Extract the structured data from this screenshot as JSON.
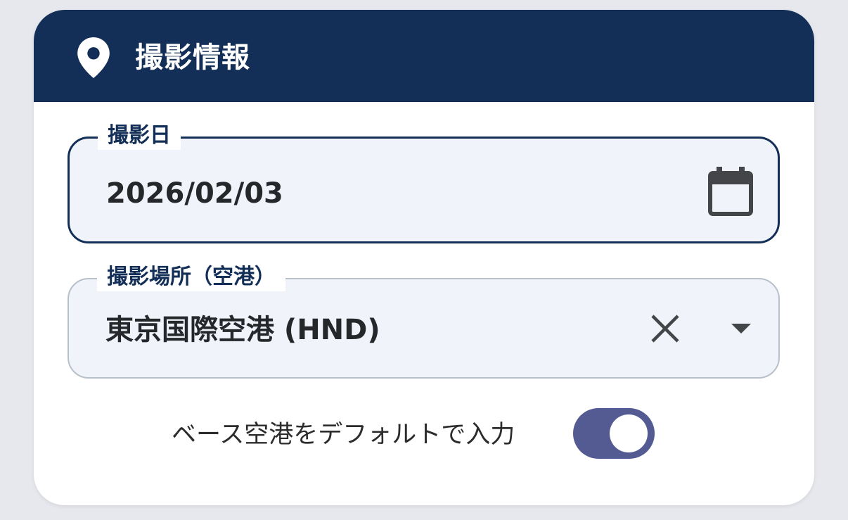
{
  "section": {
    "title": "撮影情報",
    "icon": "location-pin-icon",
    "header_color": "#132f57"
  },
  "date_field": {
    "label": "撮影日",
    "value": "2026/02/03",
    "icon": "calendar-icon"
  },
  "airport_field": {
    "label": "撮影場所（空港）",
    "value": "東京国際空港 (HND)",
    "clear_icon": "close-icon",
    "dropdown_icon": "dropdown-arrow-icon"
  },
  "base_airport_toggle": {
    "label": "ベース空港をデフォルトで入力",
    "checked": true,
    "color": "#535b92"
  }
}
